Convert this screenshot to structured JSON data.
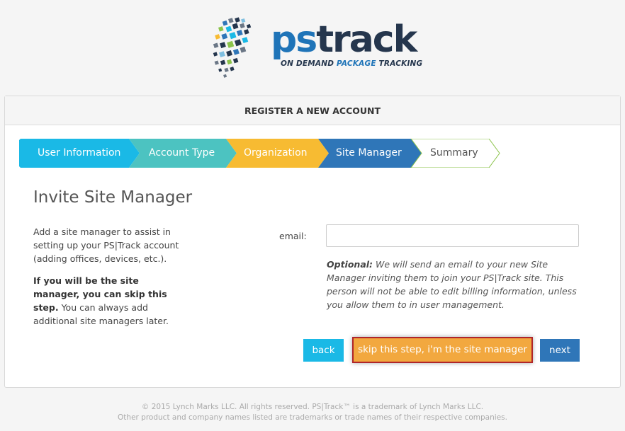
{
  "brand": {
    "name_prefix": "ps",
    "name_suffix": "track",
    "tagline_part1": "ON DEMAND ",
    "tagline_highlight": "PACKAGE",
    "tagline_part2": " TRACKING"
  },
  "panel": {
    "title": "REGISTER A NEW ACCOUNT"
  },
  "steps": [
    {
      "label": "User Information",
      "color": "#1ab9e6"
    },
    {
      "label": "Account Type",
      "color": "#4cc3c1"
    },
    {
      "label": "Organization",
      "color": "#f7bb32"
    },
    {
      "label": "Site Manager",
      "color": "#2f76b8"
    },
    {
      "label": "Summary",
      "color": "#ffffff"
    }
  ],
  "section": {
    "title": "Invite Site Manager",
    "desc_1": "Add a site manager to assist in setting up your PS|Track account (adding offices, devices, etc.).",
    "desc_2_bold": "If you will be the site manager, you can skip this step.",
    "desc_2_rest": " You can always add additional site managers later."
  },
  "form": {
    "email_label": "email:",
    "email_value": "",
    "hint_bold": "Optional:",
    "hint_rest": " We will send an email to your new Site Manager inviting them to join your PS|Track site. This person will not be able to edit billing information, unless you allow them to in user management."
  },
  "buttons": {
    "back": "back",
    "skip": "skip this step, i'm the site manager",
    "next": "next"
  },
  "footer": {
    "line1": "© 2015 Lynch Marks LLC. All rights reserved. PS|Track™ is a trademark of Lynch Marks LLC.",
    "line2": "Other product and company names listed are trademarks or trade names of their respective companies."
  }
}
